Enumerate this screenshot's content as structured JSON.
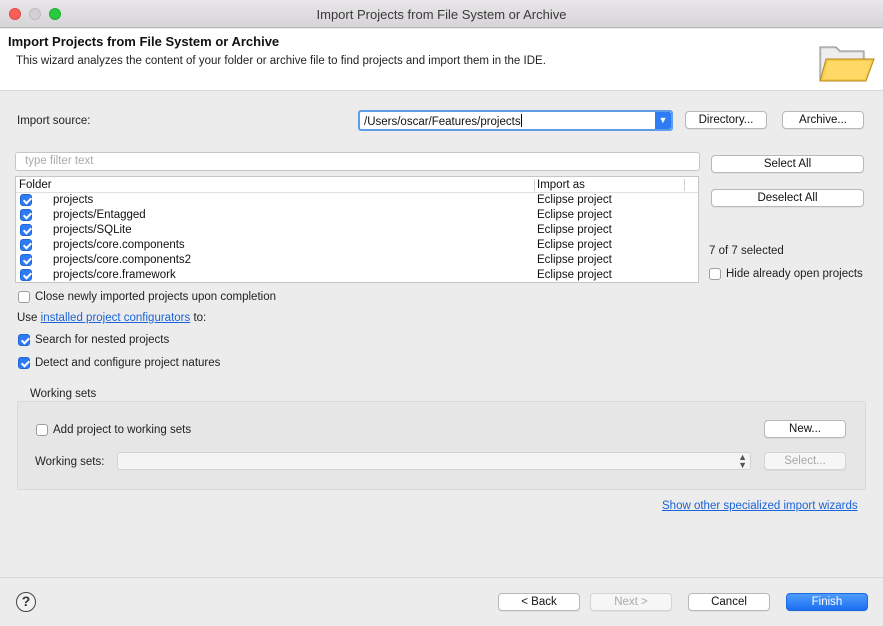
{
  "window": {
    "title": "Import Projects from File System or Archive"
  },
  "header": {
    "title": "Import Projects from File System or Archive",
    "description": "This wizard analyzes the content of your folder or archive file to find projects and import them in the IDE.",
    "icon": "folder-open-icon"
  },
  "source": {
    "label": "Import source:",
    "value": "/Users/oscar/Features/projects",
    "directory_label": "Directory...",
    "archive_label": "Archive..."
  },
  "filter": {
    "placeholder": "type filter text"
  },
  "table": {
    "columns": [
      "Folder",
      "Import as"
    ],
    "rows": [
      {
        "folder": "projects",
        "import_as": "Eclipse project",
        "checked": true
      },
      {
        "folder": "projects/Entagged",
        "import_as": "Eclipse project",
        "checked": true
      },
      {
        "folder": "projects/SQLite",
        "import_as": "Eclipse project",
        "checked": true
      },
      {
        "folder": "projects/core.components",
        "import_as": "Eclipse project",
        "checked": true
      },
      {
        "folder": "projects/core.components2",
        "import_as": "Eclipse project",
        "checked": true
      },
      {
        "folder": "projects/core.framework",
        "import_as": "Eclipse project",
        "checked": true
      }
    ]
  },
  "side": {
    "select_all": "Select All",
    "deselect_all": "Deselect All",
    "selected_count": "7 of 7 selected",
    "hide_open": "Hide already open projects"
  },
  "options": {
    "close_imported": "Close newly imported projects upon completion",
    "use_prefix": "Use",
    "configurators_link": "installed project configurators",
    "use_suffix": "to:",
    "search_nested": "Search for nested projects",
    "detect_natures": "Detect and configure project natures"
  },
  "working_sets": {
    "group_label": "Working sets",
    "add_label": "Add project to working sets",
    "new_label": "New...",
    "sets_label": "Working sets:",
    "select_label": "Select..."
  },
  "other_wizards_link": "Show other specialized import wizards",
  "footer": {
    "back": "< Back",
    "next": "Next >",
    "cancel": "Cancel",
    "finish": "Finish",
    "help": "?"
  },
  "colors": {
    "accent": "#2d7cf6",
    "link": "#1a63d8"
  }
}
